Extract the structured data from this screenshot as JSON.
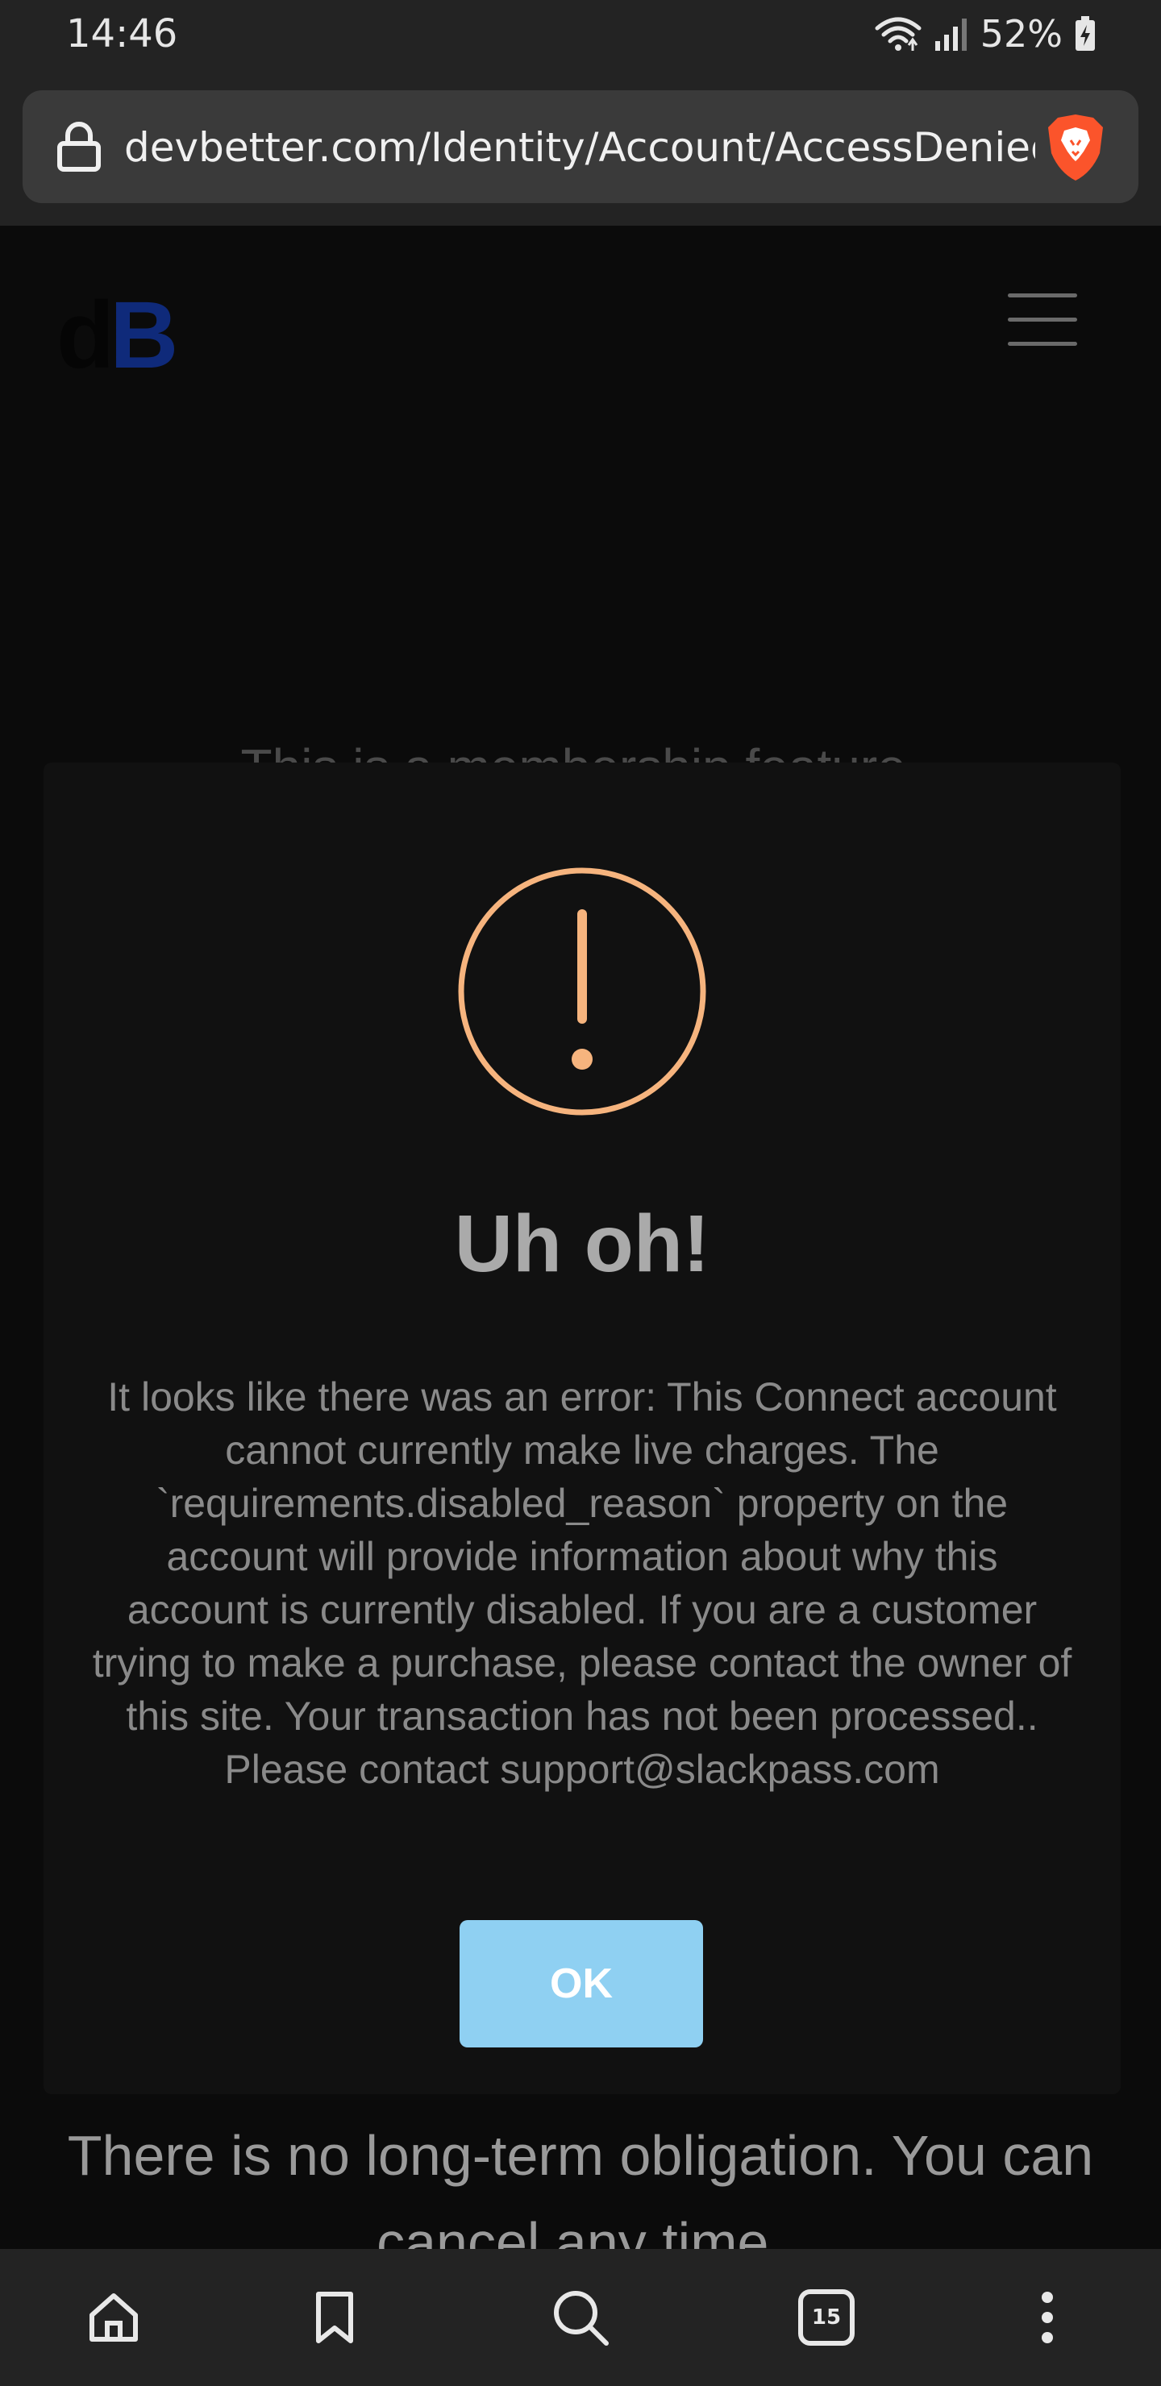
{
  "status_bar": {
    "time": "14:46",
    "battery": "52%",
    "icons": [
      "wifi-icon",
      "signal-icon",
      "battery-charging-icon"
    ]
  },
  "browser": {
    "url": "devbetter.com/Identity/Account/AccessDenied",
    "icons": [
      "lock-icon",
      "brave-shield-icon"
    ],
    "tabs_count": "15",
    "nav_icons": [
      "home-icon",
      "bookmark-icon",
      "search-icon",
      "tabs-icon",
      "more-icon"
    ]
  },
  "page": {
    "logo_d": "d",
    "logo_b": "B",
    "partial_text": "This is a membership feature.",
    "bottom_text_line1": "There is no long-term obligation. You can",
    "bottom_text_line2": "cancel any time."
  },
  "modal": {
    "icon": "alert-circle-icon",
    "title": "Uh oh!",
    "message": "It looks like there was an error: This Connect account cannot currently make live charges. The `requirements.disabled_reason` property on the account will provide information about why this account is currently disabled. If you are a customer trying to make a purchase, please contact the owner of this site. Your transaction has not been processed.. Please contact support@slackpass.com",
    "ok_label": "OK"
  },
  "colors": {
    "accent_orange": "#f6b47e",
    "button_blue": "#8fd0f2",
    "logo_blue": "#0f2a7a"
  }
}
